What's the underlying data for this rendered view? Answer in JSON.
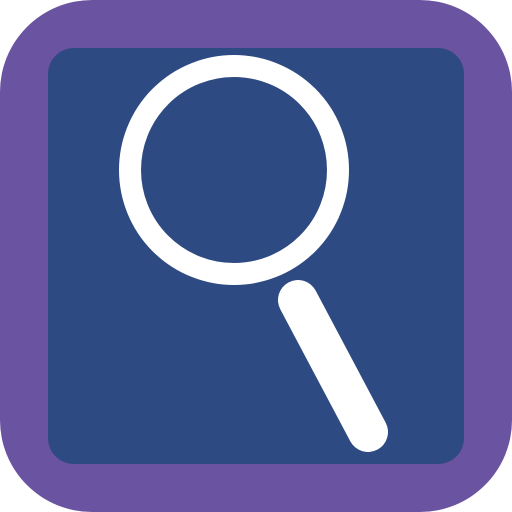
{
  "icon": {
    "name": "search-icon",
    "colors": {
      "frame": "#6a53a1",
      "inner": "#2e4a82",
      "glyph": "#ffffff"
    }
  }
}
